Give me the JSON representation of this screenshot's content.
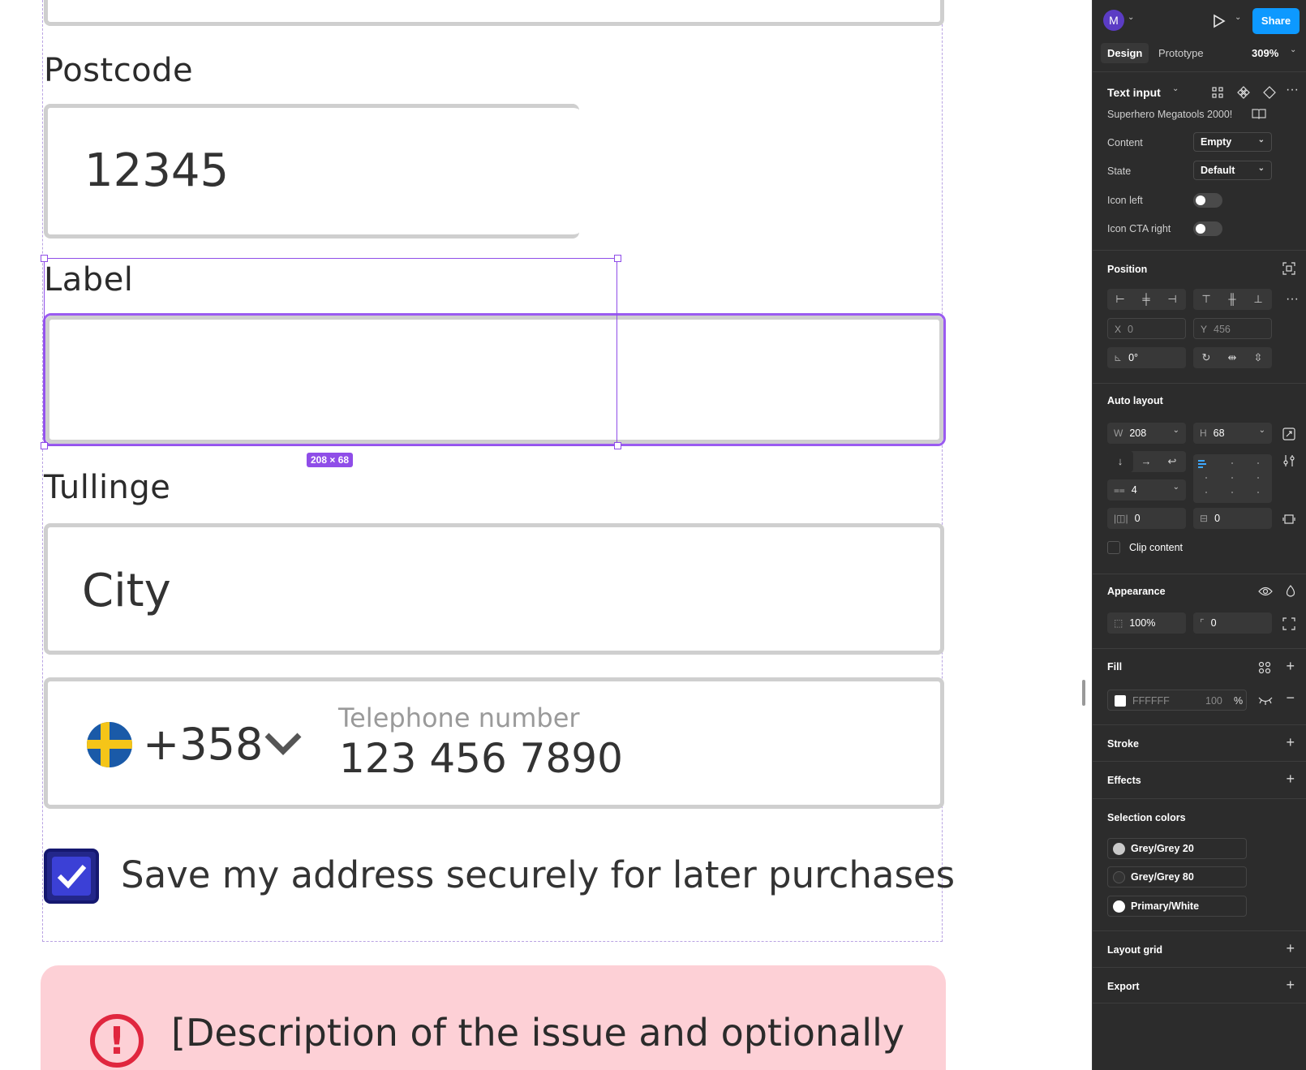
{
  "canvas": {
    "postcode_label": "Postcode",
    "postcode_value": "12345",
    "label_text": "Label",
    "selection_size": "208 × 68",
    "tullinge_label": "Tullinge",
    "city_value": "City",
    "phone_prefix": "+358",
    "phone_label": "Telephone number",
    "phone_value": "123 456 7890",
    "checkbox_text": "Save my address securely for later purchases",
    "alert_line1": "[Description of the issue and optionally",
    "alert_line2": "",
    "alert_icon": "!"
  },
  "panel": {
    "avatar_letter": "M",
    "share_label": "Share",
    "tabs": [
      "Design",
      "Prototype"
    ],
    "zoom": "309%",
    "component_name": "Text input",
    "library_name": "Superhero Megatools 2000!",
    "props": {
      "content_label": "Content",
      "content_value": "Empty",
      "state_label": "State",
      "state_value": "Default",
      "icon_left_label": "Icon left",
      "icon_cta_right_label": "Icon CTA right"
    },
    "position": {
      "title": "Position",
      "x_label": "X",
      "x_value": "0",
      "y_label": "Y",
      "y_value": "456",
      "rotation": "0°"
    },
    "auto_layout": {
      "title": "Auto layout",
      "w_label": "W",
      "w_value": "208",
      "h_label": "H",
      "h_value": "68",
      "gap": "4",
      "pad_h": "0",
      "pad_v": "0",
      "clip_label": "Clip content"
    },
    "appearance": {
      "title": "Appearance",
      "opacity": "100%",
      "radius": "0"
    },
    "fill": {
      "title": "Fill",
      "hex": "FFFFFF",
      "opacity": "100",
      "pct": "%"
    },
    "stroke_title": "Stroke",
    "effects_title": "Effects",
    "selection_colors": {
      "title": "Selection colors",
      "items": [
        {
          "name": "Grey/Grey 20",
          "color": "#c9c9c9"
        },
        {
          "name": "Grey/Grey 80",
          "color": "#333333"
        },
        {
          "name": "Primary/White",
          "color": "#ffffff"
        }
      ]
    },
    "layout_grid_title": "Layout grid",
    "export_title": "Export"
  },
  "colors": {
    "accent": "#8f4de8",
    "share_blue": "#0d99ff",
    "alert_bg": "#fdd0d6",
    "alert_red": "#e0263e",
    "checkbox_blue": "#23278a"
  }
}
